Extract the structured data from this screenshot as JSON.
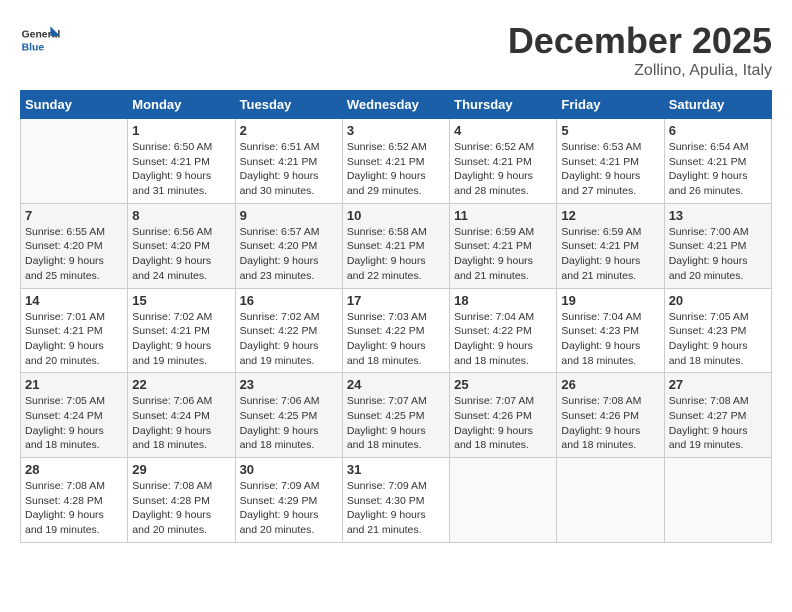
{
  "header": {
    "logo_general": "General",
    "logo_blue": "Blue",
    "month": "December 2025",
    "location": "Zollino, Apulia, Italy"
  },
  "weekdays": [
    "Sunday",
    "Monday",
    "Tuesday",
    "Wednesday",
    "Thursday",
    "Friday",
    "Saturday"
  ],
  "weeks": [
    [
      {
        "day": "",
        "empty": true
      },
      {
        "day": "1",
        "sunrise": "6:50 AM",
        "sunset": "4:21 PM",
        "daylight": "9 hours and 31 minutes."
      },
      {
        "day": "2",
        "sunrise": "6:51 AM",
        "sunset": "4:21 PM",
        "daylight": "9 hours and 30 minutes."
      },
      {
        "day": "3",
        "sunrise": "6:52 AM",
        "sunset": "4:21 PM",
        "daylight": "9 hours and 29 minutes."
      },
      {
        "day": "4",
        "sunrise": "6:52 AM",
        "sunset": "4:21 PM",
        "daylight": "9 hours and 28 minutes."
      },
      {
        "day": "5",
        "sunrise": "6:53 AM",
        "sunset": "4:21 PM",
        "daylight": "9 hours and 27 minutes."
      },
      {
        "day": "6",
        "sunrise": "6:54 AM",
        "sunset": "4:21 PM",
        "daylight": "9 hours and 26 minutes."
      }
    ],
    [
      {
        "day": "7",
        "sunrise": "6:55 AM",
        "sunset": "4:20 PM",
        "daylight": "9 hours and 25 minutes."
      },
      {
        "day": "8",
        "sunrise": "6:56 AM",
        "sunset": "4:20 PM",
        "daylight": "9 hours and 24 minutes."
      },
      {
        "day": "9",
        "sunrise": "6:57 AM",
        "sunset": "4:20 PM",
        "daylight": "9 hours and 23 minutes."
      },
      {
        "day": "10",
        "sunrise": "6:58 AM",
        "sunset": "4:21 PM",
        "daylight": "9 hours and 22 minutes."
      },
      {
        "day": "11",
        "sunrise": "6:59 AM",
        "sunset": "4:21 PM",
        "daylight": "9 hours and 21 minutes."
      },
      {
        "day": "12",
        "sunrise": "6:59 AM",
        "sunset": "4:21 PM",
        "daylight": "9 hours and 21 minutes."
      },
      {
        "day": "13",
        "sunrise": "7:00 AM",
        "sunset": "4:21 PM",
        "daylight": "9 hours and 20 minutes."
      }
    ],
    [
      {
        "day": "14",
        "sunrise": "7:01 AM",
        "sunset": "4:21 PM",
        "daylight": "9 hours and 20 minutes."
      },
      {
        "day": "15",
        "sunrise": "7:02 AM",
        "sunset": "4:21 PM",
        "daylight": "9 hours and 19 minutes."
      },
      {
        "day": "16",
        "sunrise": "7:02 AM",
        "sunset": "4:22 PM",
        "daylight": "9 hours and 19 minutes."
      },
      {
        "day": "17",
        "sunrise": "7:03 AM",
        "sunset": "4:22 PM",
        "daylight": "9 hours and 18 minutes."
      },
      {
        "day": "18",
        "sunrise": "7:04 AM",
        "sunset": "4:22 PM",
        "daylight": "9 hours and 18 minutes."
      },
      {
        "day": "19",
        "sunrise": "7:04 AM",
        "sunset": "4:23 PM",
        "daylight": "9 hours and 18 minutes."
      },
      {
        "day": "20",
        "sunrise": "7:05 AM",
        "sunset": "4:23 PM",
        "daylight": "9 hours and 18 minutes."
      }
    ],
    [
      {
        "day": "21",
        "sunrise": "7:05 AM",
        "sunset": "4:24 PM",
        "daylight": "9 hours and 18 minutes."
      },
      {
        "day": "22",
        "sunrise": "7:06 AM",
        "sunset": "4:24 PM",
        "daylight": "9 hours and 18 minutes."
      },
      {
        "day": "23",
        "sunrise": "7:06 AM",
        "sunset": "4:25 PM",
        "daylight": "9 hours and 18 minutes."
      },
      {
        "day": "24",
        "sunrise": "7:07 AM",
        "sunset": "4:25 PM",
        "daylight": "9 hours and 18 minutes."
      },
      {
        "day": "25",
        "sunrise": "7:07 AM",
        "sunset": "4:26 PM",
        "daylight": "9 hours and 18 minutes."
      },
      {
        "day": "26",
        "sunrise": "7:08 AM",
        "sunset": "4:26 PM",
        "daylight": "9 hours and 18 minutes."
      },
      {
        "day": "27",
        "sunrise": "7:08 AM",
        "sunset": "4:27 PM",
        "daylight": "9 hours and 19 minutes."
      }
    ],
    [
      {
        "day": "28",
        "sunrise": "7:08 AM",
        "sunset": "4:28 PM",
        "daylight": "9 hours and 19 minutes."
      },
      {
        "day": "29",
        "sunrise": "7:08 AM",
        "sunset": "4:28 PM",
        "daylight": "9 hours and 20 minutes."
      },
      {
        "day": "30",
        "sunrise": "7:09 AM",
        "sunset": "4:29 PM",
        "daylight": "9 hours and 20 minutes."
      },
      {
        "day": "31",
        "sunrise": "7:09 AM",
        "sunset": "4:30 PM",
        "daylight": "9 hours and 21 minutes."
      },
      {
        "day": "",
        "empty": true
      },
      {
        "day": "",
        "empty": true
      },
      {
        "day": "",
        "empty": true
      }
    ]
  ]
}
